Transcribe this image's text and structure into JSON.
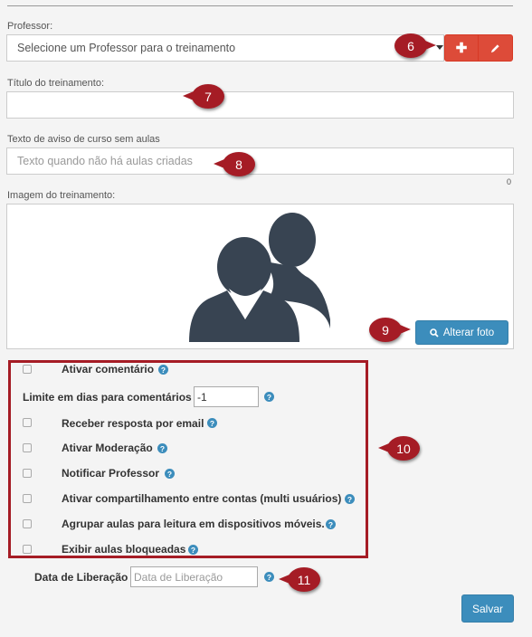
{
  "professor": {
    "label": "Professor:",
    "selected": "Selecione um Professor para o treinamento",
    "add_icon": "plus-icon",
    "edit_icon": "pencil-icon"
  },
  "titulo": {
    "label": "Título do treinamento:",
    "value": ""
  },
  "aviso": {
    "label": "Texto de aviso de curso sem aulas",
    "placeholder": "Texto quando não há aulas criadas",
    "counter": "0"
  },
  "imagem": {
    "label": "Imagem do treinamento:",
    "button_label": "Alterar foto",
    "button_icon": "search-icon"
  },
  "options": {
    "ativar_comentario": "Ativar comentário",
    "limite_label": "Limite em dias para comentários",
    "limite_value": "-1",
    "receber_resposta": "Receber resposta por email",
    "ativar_moderacao": "Ativar Moderação",
    "notificar_professor": "Notificar Professor",
    "ativar_compartilhamento": "Ativar compartilhamento entre contas (multi usuários)",
    "agrupar_aulas": "Agrupar aulas para leitura em dispositivos móveis.",
    "exibir_bloqueadas": "Exibir aulas bloqueadas",
    "help_glyph": "?"
  },
  "data_liberacao": {
    "label": "Data de Liberação",
    "placeholder": "Data de Liberação"
  },
  "save_label": "Salvar",
  "callouts": {
    "c6": "6",
    "c7": "7",
    "c8": "8",
    "c9": "9",
    "c10": "10",
    "c11": "11"
  },
  "colors": {
    "callout": "#a51c25",
    "primary": "#3c8dbc",
    "danger": "#dd4b39"
  }
}
